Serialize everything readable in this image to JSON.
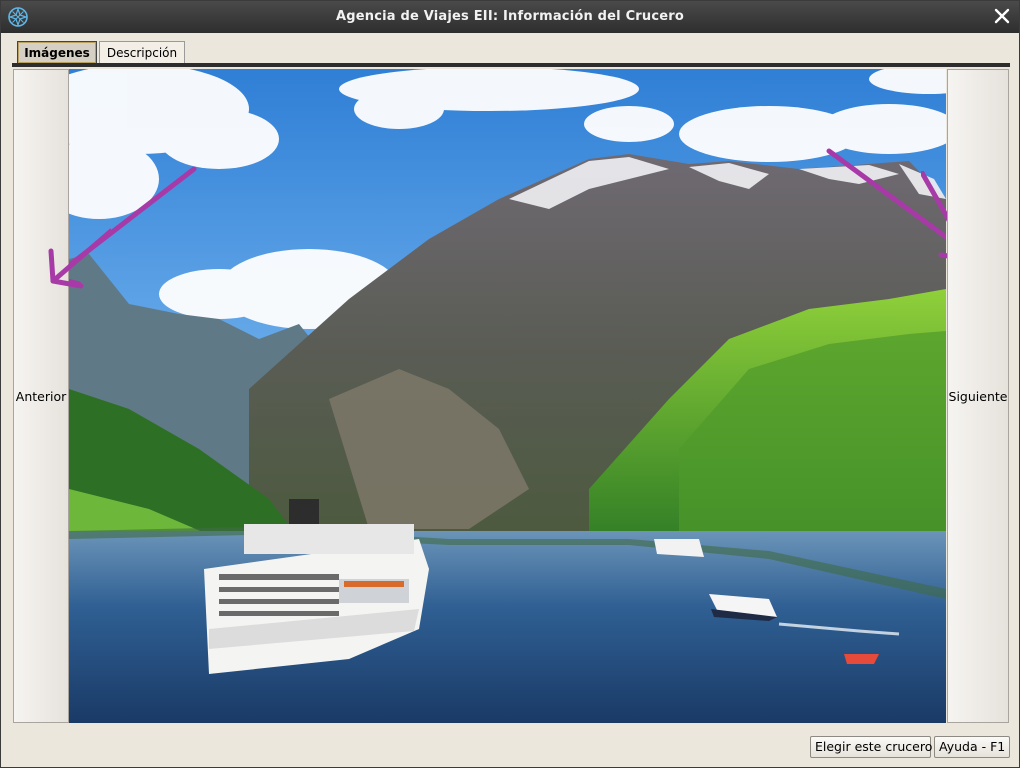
{
  "window": {
    "title": "Agencia de Viajes EII: Información del Crucero"
  },
  "tabs": [
    {
      "label": "Imágenes",
      "active": true
    },
    {
      "label": "Descripción",
      "active": false
    }
  ],
  "gallery": {
    "prev_label": "Anterior",
    "next_label": "Siguiente"
  },
  "footer": {
    "choose_label": "Elegir este crucero",
    "help_label": "Ayuda - F1"
  },
  "colors": {
    "titlebar": "#2e2e2e",
    "annotation_arrow": "#a83aa8"
  },
  "icons": {
    "app": "compass-star-icon",
    "close": "close-icon"
  }
}
